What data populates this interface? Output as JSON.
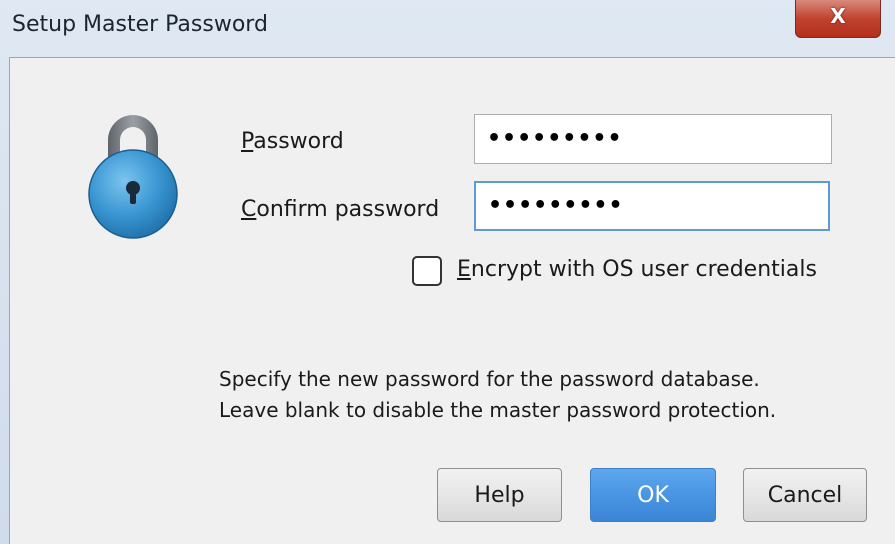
{
  "window": {
    "title": "Setup Master Password",
    "close_label": "X"
  },
  "form": {
    "password_label_mnemonic": "P",
    "password_label_rest": "assword",
    "password_value": "•••••••••",
    "confirm_label_mnemonic": "C",
    "confirm_label_rest": "onfirm password",
    "confirm_value": "•••••••••",
    "encrypt_label_mnemonic": "E",
    "encrypt_label_rest": "ncrypt with OS user credentials",
    "encrypt_checked": false
  },
  "description": {
    "line1": "Specify the new password for the password database.",
    "line2": "Leave blank to disable the master password protection."
  },
  "buttons": {
    "help": "Help",
    "ok": "OK",
    "cancel": "Cancel"
  },
  "colors": {
    "ok_button": "#4a95e3",
    "lock_blue": "#3b97d3",
    "close_red": "#c0432f"
  },
  "icons": {
    "lock": "padlock-icon",
    "close": "close-icon"
  }
}
